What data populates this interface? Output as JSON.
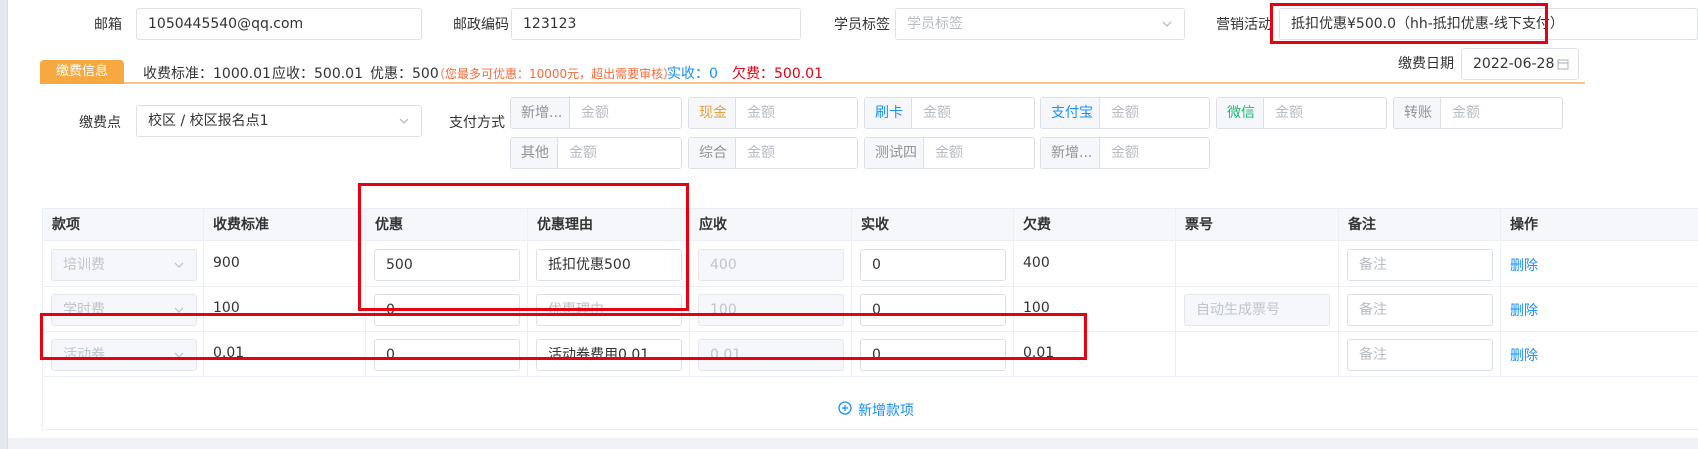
{
  "form": {
    "email_label": "邮箱",
    "email_value": "1050445540@qq.com",
    "zip_label": "邮政编码",
    "zip_value": "123123",
    "student_tag_label": "学员标签",
    "student_tag_placeholder": "学员标签",
    "marketing_label": "营销活动",
    "marketing_value": "抵扣优惠¥500.0（hh-抵扣优惠-线下支付）"
  },
  "summary": {
    "section_tag": "缴费信息",
    "standard": "收费标准：1000.01",
    "receivable": "应收：500.01",
    "discount": "优惠：500",
    "discount_note": "（您最多可优惠：10000元，超出需要审核）",
    "actual": "实收：0",
    "owed": "欠费：500.01",
    "date_label": "缴费日期",
    "date_value": "2022-06-28"
  },
  "payment": {
    "point_label": "缴费点",
    "point_value": "校区 / 校区报名点1",
    "method_label": "支付方式",
    "amount_placeholder": "金额",
    "methods_row1": [
      {
        "name": "新增...",
        "color": "#909399"
      },
      {
        "name": "现金",
        "color": "#e6a23c"
      },
      {
        "name": "刷卡",
        "color": "#1890ff"
      },
      {
        "name": "支付宝",
        "color": "#1890ff"
      },
      {
        "name": "微信",
        "color": "#19be6b"
      },
      {
        "name": "转账",
        "color": "#909399"
      }
    ],
    "methods_row2": [
      {
        "name": "其他",
        "color": "#909399"
      },
      {
        "name": "综合",
        "color": "#909399"
      },
      {
        "name": "测试四",
        "color": "#909399"
      },
      {
        "name": "新增...",
        "color": "#909399"
      }
    ]
  },
  "table": {
    "headers": [
      "款项",
      "收费标准",
      "优惠",
      "优惠理由",
      "应收",
      "实收",
      "欠费",
      "票号",
      "备注",
      "操作"
    ],
    "rows": [
      {
        "item": "培训费",
        "standard": "900",
        "discount": "500",
        "reason": "抵扣优惠500",
        "receivable": "400",
        "actual": "0",
        "owed": "400",
        "note_placeholder": "备注",
        "action": "删除"
      },
      {
        "item": "学时费",
        "standard": "100",
        "discount": "0",
        "reason_placeholder": "优惠理由",
        "receivable": "100",
        "actual": "0",
        "owed": "100",
        "note_placeholder": "备注",
        "action": "删除"
      },
      {
        "item": "活动券",
        "standard": "0.01",
        "discount": "0",
        "reason": "活动券费用0.01",
        "receivable": "0.01",
        "actual": "0",
        "owed": "0.01",
        "note_placeholder": "备注",
        "action": "删除"
      }
    ],
    "ticket_placeholder": "自动生成票号",
    "add_label": "新增款项"
  },
  "colors": {
    "accent": "#1890ff",
    "orange_tag": "#f7a841",
    "highlight_red": "#e60012",
    "owed_red": "#e60012",
    "note_orange": "#f56c3c"
  }
}
